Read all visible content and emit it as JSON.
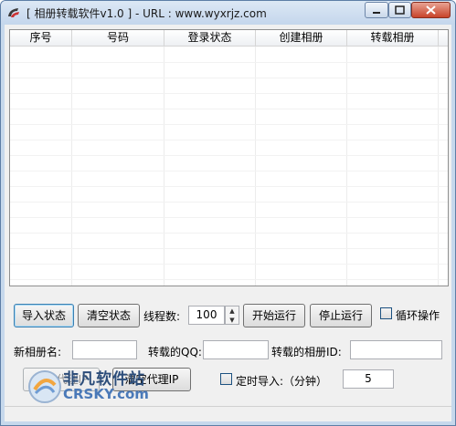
{
  "window": {
    "title": "[ 相册转载软件v1.0 ] - URL : www.wyxrjz.com"
  },
  "grid": {
    "columns": [
      "序号",
      "号码",
      "登录状态",
      "创建相册",
      "转载相册"
    ]
  },
  "controls": {
    "import_status_label": "导入状态",
    "clear_status_label": "清空状态",
    "threads_label": "线程数:",
    "threads_value": "100",
    "start_label": "开始运行",
    "stop_label": "停止运行",
    "loop_label": "循环操作",
    "loop_checked": false,
    "new_album_label": "新相册名:",
    "new_album_value": "",
    "source_qq_label": "转载的QQ:",
    "source_qq_value": "",
    "source_album_label": "转载的相册ID:",
    "source_album_value": "",
    "import_proxy_label": "导入代理IP",
    "clear_proxy_label": "清空代理IP",
    "timed_import_label": "定时导入:（分钟）",
    "timed_import_checked": false,
    "timed_value": "5"
  },
  "watermark": {
    "name": "非凡软件站",
    "site": "CRSKY.com"
  },
  "colors": {
    "frame": "#c6d8ec",
    "close_button": "#c8432a"
  }
}
